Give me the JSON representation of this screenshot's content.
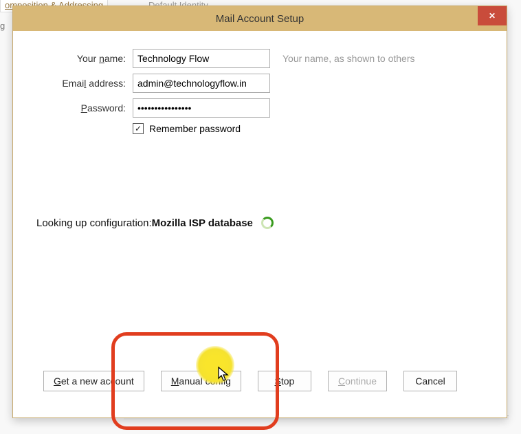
{
  "background": {
    "tab1": "omposition & Addressing",
    "tab2": "Default Identity",
    "sidebar_chars": "g"
  },
  "window": {
    "title": "Mail Account Setup"
  },
  "form": {
    "name_label_pre": "Your ",
    "name_label_key": "n",
    "name_label_post": "ame:",
    "name_value": "Technology Flow",
    "name_hint": "Your name, as shown to others",
    "email_label_pre": "Emai",
    "email_label_key": "l",
    "email_label_post": " address:",
    "email_value": "admin@technologyflow.in",
    "password_label_key": "P",
    "password_label_post": "assword:",
    "password_value": "••••••••••••••••",
    "remember_label": "Remember password",
    "remember_checked": true
  },
  "status": {
    "text_prefix": "Looking up configuration: ",
    "text_bold": "Mozilla ISP database"
  },
  "buttons": {
    "get_new": {
      "key": "G",
      "post": "et a new account"
    },
    "manual": {
      "key": "M",
      "post": "anual config"
    },
    "stop": {
      "key": "S",
      "post": "top"
    },
    "continue": {
      "key": "C",
      "post": "ontinue",
      "enabled": false
    },
    "cancel": {
      "label": "Cancel"
    }
  }
}
